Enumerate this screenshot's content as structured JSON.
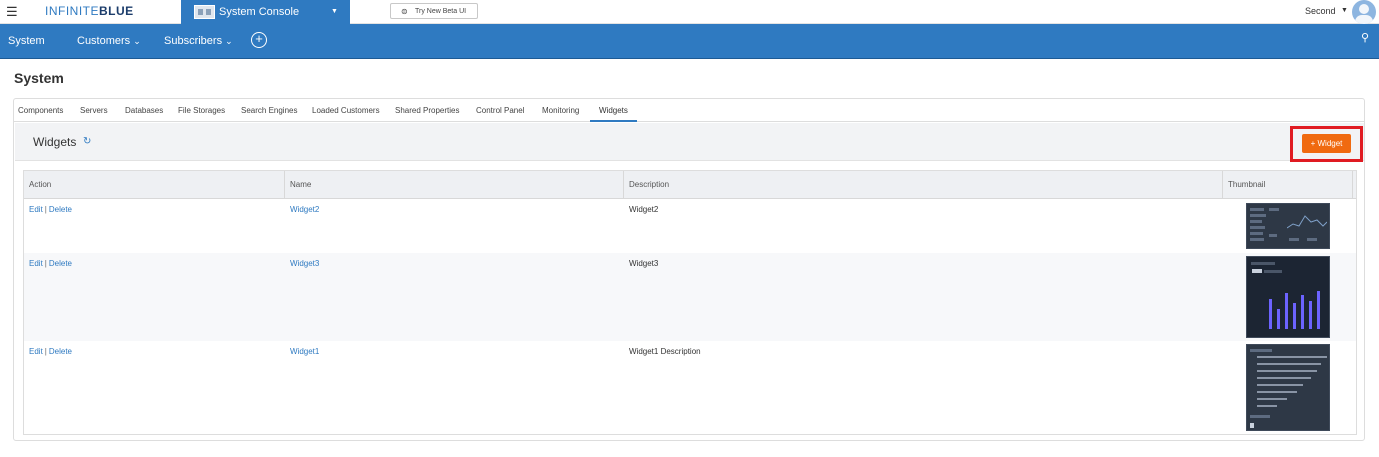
{
  "topbar": {
    "brand_thin": "INFINITE",
    "brand_bold": "BLUE",
    "app_title": "System Console",
    "beta_button": "Try New Beta UI",
    "user_name": "Second"
  },
  "nav": {
    "items": [
      {
        "label": "System"
      },
      {
        "label": "Customers"
      },
      {
        "label": "Subscribers"
      }
    ]
  },
  "page": {
    "title": "System"
  },
  "tabs": [
    {
      "label": "Components"
    },
    {
      "label": "Servers"
    },
    {
      "label": "Databases"
    },
    {
      "label": "File Storages"
    },
    {
      "label": "Search Engines"
    },
    {
      "label": "Loaded Customers"
    },
    {
      "label": "Shared Properties"
    },
    {
      "label": "Control Panel"
    },
    {
      "label": "Monitoring"
    },
    {
      "label": "Widgets"
    }
  ],
  "active_tab": "Widgets",
  "section": {
    "title": "Widgets",
    "add_button": "+ Widget"
  },
  "table": {
    "columns": [
      "Action",
      "Name",
      "Description",
      "Thumbnail"
    ],
    "edit_label": "Edit",
    "delete_label": "Delete",
    "rows": [
      {
        "name": "Widget2",
        "description": "Widget2",
        "thumbnail": "dashboard-thumbnail"
      },
      {
        "name": "Widget3",
        "description": "Widget3",
        "thumbnail": "bar-chart-thumbnail"
      },
      {
        "name": "Widget1",
        "description": "Widget1 Description",
        "thumbnail": "list-thumbnail"
      }
    ]
  },
  "colors": {
    "brand_blue": "#2f7ac1",
    "add_button": "#f06a10",
    "highlight_border": "#e01b22"
  }
}
